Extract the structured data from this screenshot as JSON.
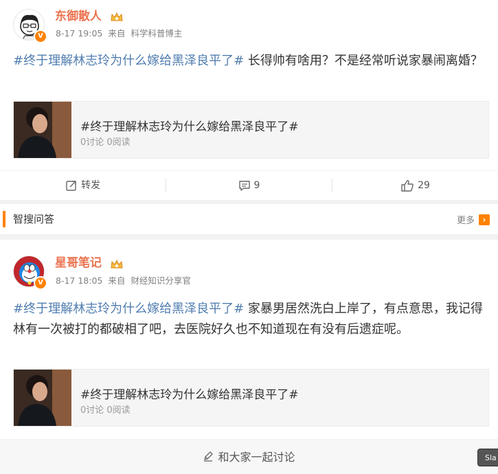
{
  "posts": [
    {
      "username": "东御散人",
      "time": "8-17 19:05",
      "source_prefix": "来自",
      "source": "科学科普博主",
      "hashtag": "#终于理解林志玲为什么嫁给黑泽良平了#",
      "body": " 长得帅有啥用？不是经常听说家暴闹离婚？",
      "topic_title": "#终于理解林志玲为什么嫁给黑泽良平了#",
      "topic_stats": "0讨论 0阅读",
      "actions": {
        "repost": "转发",
        "comments": "9",
        "likes": "29"
      }
    },
    {
      "username": "星哥笔记",
      "time": "8-17 18:05",
      "source_prefix": "来自",
      "source": "财经知识分享官",
      "hashtag": "#终于理解林志玲为什么嫁给黑泽良平了#",
      "body": " 家暴男居然洗白上岸了，有点意思，我记得林有一次被打的都破相了吧，去医院好久也不知道现在有没有后遗症呢。",
      "topic_title": "#终于理解林志玲为什么嫁给黑泽良平了#",
      "topic_stats": "0讨论 0阅读"
    }
  ],
  "zhisou": {
    "title": "智搜问答",
    "more": "更多"
  },
  "discuss_button": "和大家一起讨论",
  "slack_tag": "Sla",
  "colors": {
    "accent": "#ff8200",
    "username": "#eb7350",
    "hashtag": "#507daf"
  }
}
